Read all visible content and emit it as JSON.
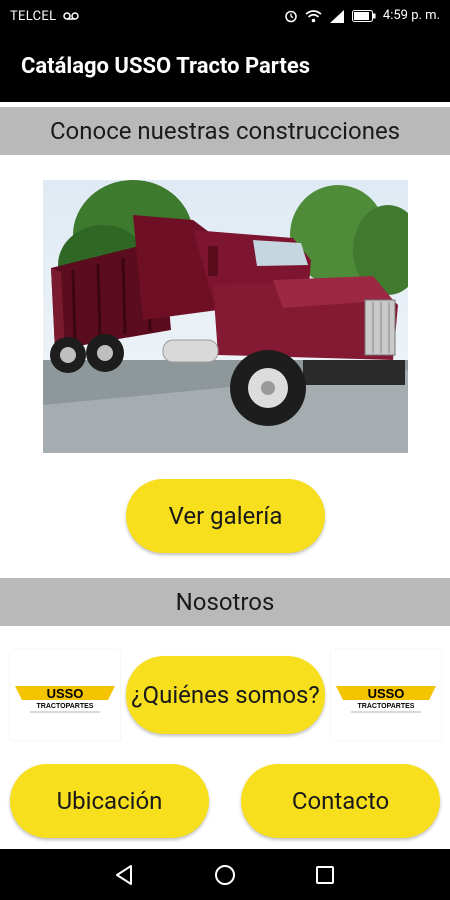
{
  "status_bar": {
    "carrier": "TELCEL",
    "time": "4:59 p. m.",
    "icons": [
      "voicemail-icon",
      "alarm-icon",
      "wifi-icon",
      "signal-icon",
      "battery-icon"
    ]
  },
  "app_bar": {
    "title": "Catálago USSO Tracto Partes"
  },
  "construcciones": {
    "header": "Conoce nuestras construcciones",
    "image_subject": "truck-photo",
    "button_label": "Ver galería"
  },
  "nosotros": {
    "header": "Nosotros",
    "who_button_label": "¿Quiénes somos?",
    "logo": {
      "brand": "USSO",
      "subtitle": "TRACTOPARTES"
    }
  },
  "actions": {
    "location_label": "Ubicación",
    "contact_label": "Contacto"
  },
  "nav_bar": {
    "icons": [
      "back-icon",
      "home-icon",
      "recents-icon"
    ]
  },
  "colors": {
    "accent": "#f7df1e",
    "section": "#b9b9b9",
    "bar": "#000000",
    "truck": "#6e0f25"
  }
}
